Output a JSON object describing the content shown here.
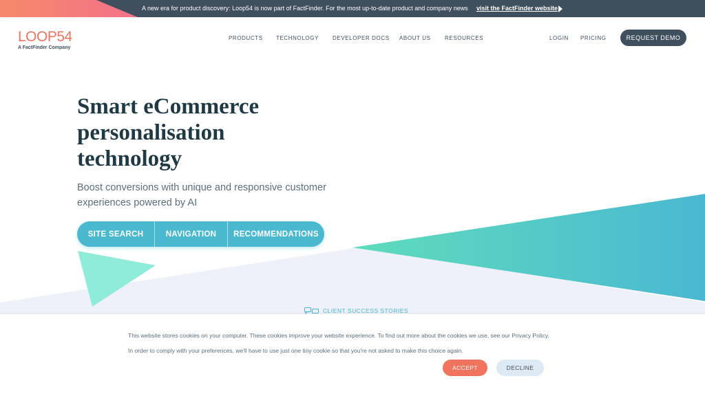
{
  "announcement": {
    "text": "A new era for product discovery: Loop54 is now part of FactFinder. For the most up-to-date product and company news",
    "link": "visit the FactFinder website"
  },
  "brand": {
    "name": "LOOP54",
    "tagline": "A FactFinder Company"
  },
  "nav": {
    "items": [
      "PRODUCTS",
      "TECHNOLOGY",
      "DEVELOPER DOCS",
      "ABOUT US",
      "RESOURCES"
    ],
    "login": "LOGIN",
    "pricing": "PRICING",
    "cta": "REQUEST DEMO"
  },
  "hero": {
    "title_lines": [
      "Smart eCommerce",
      "personalisation",
      "technology"
    ],
    "subtitle_lines": [
      "Boost conversions with unique and responsive customer",
      "experiences powered by AI"
    ],
    "buttons": [
      "SITE SEARCH",
      "NAVIGATION",
      "RECOMMENDATIONS"
    ]
  },
  "client_stories": {
    "label": "CLIENT SUCCESS STORIES",
    "icon": "chat-bubbles-icon"
  },
  "cookie": {
    "line1": "This website stores cookies on your computer. These cookies improve your website experience. To find out more about the cookies we use, see our Privacy Policy.",
    "line2": "In order to comply with your preferences, we'll have to use just one tiny cookie so that you're not asked to make this choice again.",
    "accept": "ACCEPT",
    "decline": "DECLINE"
  },
  "colors": {
    "brand_coral": "#f0735e",
    "dark_slate": "#3f4f5e",
    "teal": "#4ab8cf",
    "mint": "#8eecd9",
    "heading": "#1f3a45"
  }
}
